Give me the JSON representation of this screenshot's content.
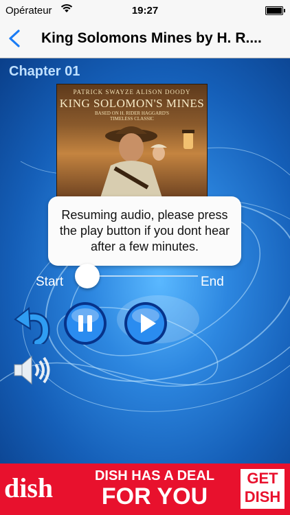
{
  "status_bar": {
    "carrier": "Opérateur",
    "time": "19:27"
  },
  "nav": {
    "back_icon": "chevron-left-icon",
    "title": "King Solomons Mines by H. R...."
  },
  "player": {
    "chapter": "Chapter 01",
    "cover": {
      "credits": "PATRICK SWAYZE  ALISON DOODY",
      "title": "KING SOLOMON'S MINES",
      "tagline_line1": "BASED ON H. RIDER HAGGARD'S",
      "tagline_line2": "TIMELESS CLASSIC"
    },
    "message": "Resuming audio, please press the play button if you dont hear after a few minutes.",
    "slider": {
      "start_label": "Start",
      "end_label": "End",
      "position": 0
    },
    "controls": {
      "replay_icon": "replay-arrow-icon",
      "pause_icon": "pause-icon",
      "play_icon": "play-icon",
      "volume_icon": "speaker-volume-icon"
    }
  },
  "ad": {
    "logo": "dish",
    "headline_line1": "DISH HAS A DEAL",
    "headline_line2": "FOR YOU",
    "cta_line1": "GET",
    "cta_line2": "DISH"
  },
  "colors": {
    "nav_accent": "#1a7cf5",
    "ad_red": "#e8112d",
    "ad_text": "#ffffff"
  }
}
